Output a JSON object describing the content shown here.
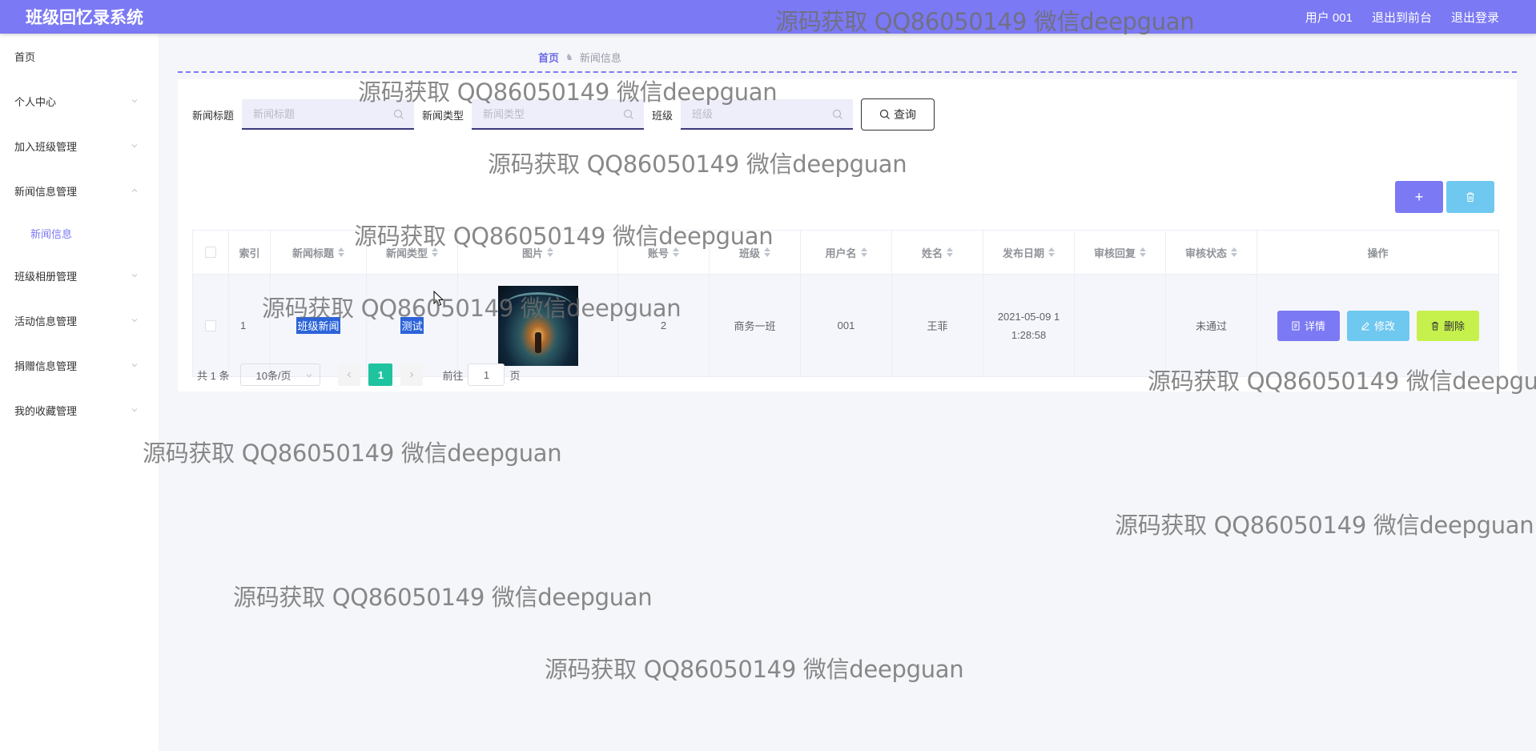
{
  "app": {
    "title": "班级回忆录系统"
  },
  "header": {
    "user": "用户 001",
    "to_front": "退出到前台",
    "logout": "退出登录"
  },
  "sidebar": {
    "items": [
      {
        "label": "首页",
        "has_chevron": false
      },
      {
        "label": "个人中心",
        "has_chevron": true
      },
      {
        "label": "加入班级管理",
        "has_chevron": true
      },
      {
        "label": "新闻信息管理",
        "has_chevron": true,
        "expanded": true
      },
      {
        "label": "班级相册管理",
        "has_chevron": true
      },
      {
        "label": "活动信息管理",
        "has_chevron": true
      },
      {
        "label": "捐赠信息管理",
        "has_chevron": true
      },
      {
        "label": "我的收藏管理",
        "has_chevron": true
      }
    ],
    "sub_item": "新闻信息"
  },
  "breadcrumb": {
    "home": "首页",
    "current": "新闻信息"
  },
  "search": {
    "title_label": "新闻标题",
    "title_placeholder": "新闻标题",
    "type_label": "新闻类型",
    "type_placeholder": "新闻类型",
    "class_label": "班级",
    "class_placeholder": "班级",
    "query_label": "查询"
  },
  "actions": {
    "add": "+"
  },
  "table": {
    "columns": [
      "索引",
      "新闻标题",
      "新闻类型",
      "图片",
      "账号",
      "班级",
      "用户名",
      "姓名",
      "发布日期",
      "审核回复",
      "审核状态",
      "操作"
    ],
    "rows": [
      {
        "index": "1",
        "title": "班级新闻",
        "type": "测试",
        "account": "2",
        "class": "商务一班",
        "username": "001",
        "name": "王菲",
        "date_line1": "2021-05-09 1",
        "date_line2": "1:28:58",
        "reply": "",
        "status": "未通过"
      }
    ],
    "op_detail": "详情",
    "op_edit": "修改",
    "op_delete": "删除"
  },
  "pagination": {
    "total": "共 1 条",
    "page_size": "10条/页",
    "current": "1",
    "goto_label": "前往",
    "goto_value": "1",
    "page_unit": "页"
  },
  "watermark": "源码获取 QQ86050149 微信deepguan",
  "colors": {
    "primary": "#7b79f3",
    "cyan": "#6fc8ef",
    "lime": "#c6f04c",
    "page_active": "#1fc39f"
  }
}
